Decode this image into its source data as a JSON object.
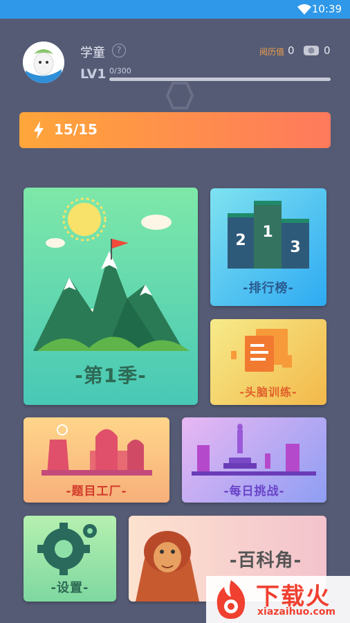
{
  "status_bar": {
    "time": "10:39",
    "wifi_icon": "wifi-icon"
  },
  "profile": {
    "name": "学童",
    "help_icon": "?",
    "level": "LV1",
    "xp_text": "0/300",
    "xp_progress": 0.0,
    "experience_label": "阅历值",
    "experience_value": "0",
    "coin_icon": "coin-icon",
    "coin_value": "0"
  },
  "energy": {
    "icon": "lightning-icon",
    "text": "15/15"
  },
  "cards": {
    "season": "-第1季-",
    "leaderboard": "-排行榜-",
    "brain_training": "-头脑训练-",
    "question_factory": "-题目工厂-",
    "daily_challenge": "-每日挑战-",
    "settings": "-设置-",
    "encyclopedia": "-百科角-"
  },
  "podium_numbers": [
    "2",
    "1",
    "3"
  ],
  "watermark": {
    "text": "下载火",
    "url": "xiazaihuo.com"
  },
  "colors": {
    "background": "#555b75",
    "status_bar": "#2f98e8",
    "energy_start": "#ffa63a",
    "energy_end": "#ff7a5c"
  }
}
